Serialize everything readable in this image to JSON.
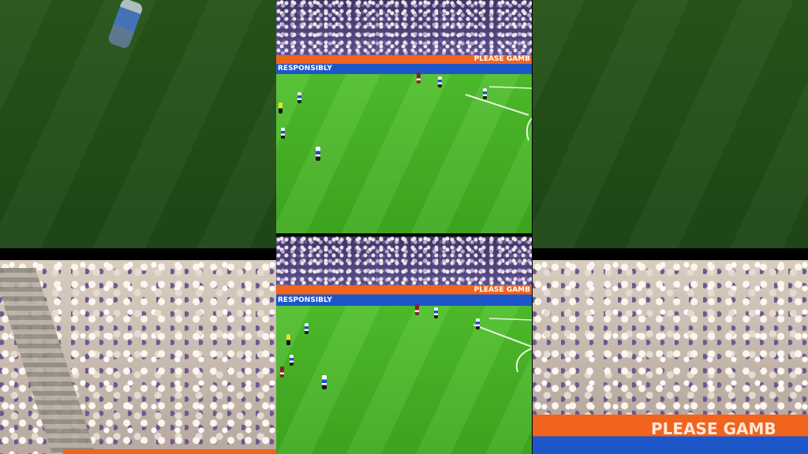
{
  "scene": {
    "description_alt": "",
    "boards": {
      "top_left_text": "RESPONSIBLY",
      "top_right_text": "PLEASE GAMB",
      "bottom_right_text": "PLEASE GAMB"
    },
    "colors": {
      "pitch_green": "#46b526",
      "board_orange": "#f0641e",
      "board_blue": "#1d56c9",
      "home_kit": "#1f4fd1",
      "away_kit": "#8b1e2c",
      "referee_kit": "#e8e02a"
    }
  }
}
